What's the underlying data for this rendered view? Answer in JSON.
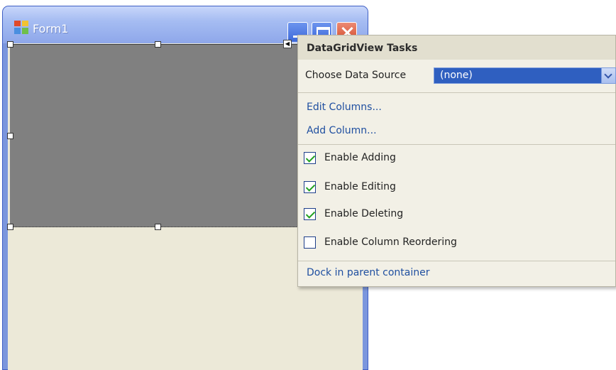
{
  "form": {
    "title": "Form1"
  },
  "tasks": {
    "title": "DataGridView Tasks",
    "data_source": {
      "label": "Choose Data Source",
      "value": "(none)"
    },
    "links": {
      "edit_columns": "Edit Columns...",
      "add_column": "Add Column...",
      "dock": "Dock in parent container"
    },
    "options": [
      {
        "label": "Enable Adding",
        "checked": true
      },
      {
        "label": "Enable Editing",
        "checked": true
      },
      {
        "label": "Enable Deleting",
        "checked": true
      },
      {
        "label": "Enable Column Reordering",
        "checked": false
      }
    ]
  },
  "colors": {
    "grid_background": "#808080",
    "form_background": "#ece9d8",
    "selection_blue": "#2f5fc0",
    "link_blue": "#1f4fa0"
  }
}
